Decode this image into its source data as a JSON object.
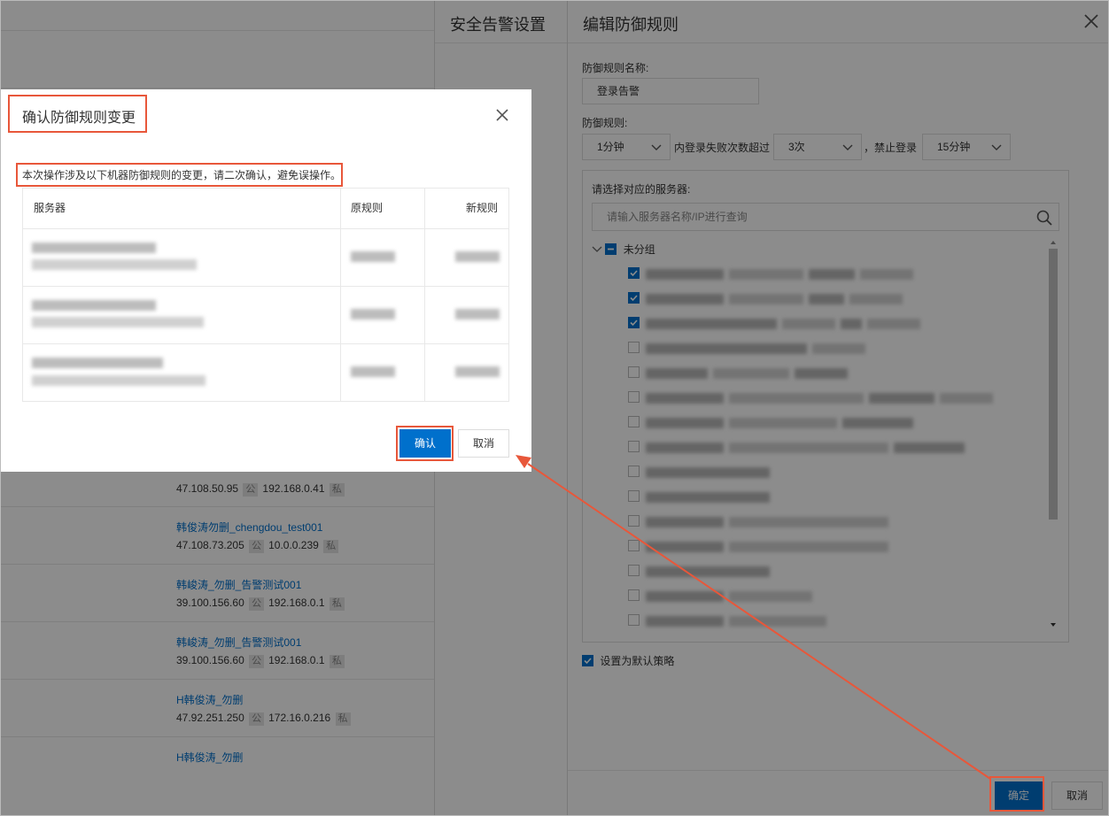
{
  "background_list": {
    "servers": [
      {
        "name": "",
        "ip_public": "47.108.50.95",
        "public_tag": "公",
        "ip_private": "192.168.0.41",
        "private_tag": "私"
      },
      {
        "name": "韩俊涛勿删_chengdou_test001",
        "ip_public": "47.108.73.205",
        "public_tag": "公",
        "ip_private": "10.0.0.239",
        "private_tag": "私"
      },
      {
        "name": "韩峻涛_勿删_告警测试001",
        "ip_public": "39.100.156.60",
        "public_tag": "公",
        "ip_private": "192.168.0.1",
        "private_tag": "私"
      },
      {
        "name": "韩峻涛_勿删_告警测试001",
        "ip_public": "39.100.156.60",
        "public_tag": "公",
        "ip_private": "192.168.0.1",
        "private_tag": "私"
      },
      {
        "name": "H韩俊涛_勿删",
        "ip_public": "47.92.251.250",
        "public_tag": "公",
        "ip_private": "172.16.0.216",
        "private_tag": "私"
      },
      {
        "name": "H韩俊涛_勿删",
        "ip_public": "",
        "public_tag": "",
        "ip_private": "",
        "private_tag": ""
      }
    ]
  },
  "panel_alarm": {
    "title": "安全告警设置"
  },
  "panel_rule": {
    "title": "编辑防御规则",
    "name_label": "防御规则名称:",
    "name_value": "登录告警",
    "rule_label": "防御规则:",
    "period_value": "1分钟",
    "mid_text_1": "内登录失败次数超过",
    "count_value": "3次",
    "mid_text_2": "，禁止登录",
    "ban_value": "15分钟",
    "server_label": "请选择对应的服务器:",
    "search_placeholder": "请输入服务器名称/IP进行查询",
    "group_label": "未分组",
    "default_label": "设置为默认策略",
    "ok_label": "确定",
    "cancel_label": "取消"
  },
  "dialog": {
    "title": "确认防御规则变更",
    "description": "本次操作涉及以下机器防御规则的变更，请二次确认，避免误操作。",
    "columns": [
      "服务器",
      "原规则",
      "新规则"
    ],
    "ok_label": "确认",
    "cancel_label": "取消"
  },
  "colors": {
    "primary": "#0070cc",
    "highlight": "#e8573a"
  }
}
